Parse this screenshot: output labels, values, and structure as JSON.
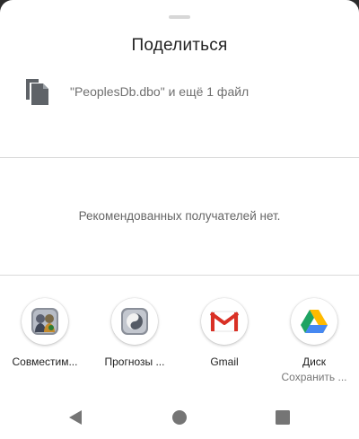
{
  "sheet": {
    "title": "Поделиться",
    "files_text": "\"PeoplesDb.dbo\" и ещё 1 файл",
    "files_icon": "copy-files-icon",
    "empty_text": "Рекомендованных получателей нет."
  },
  "apps": [
    {
      "label": "Совместим...",
      "sublabel": "",
      "icon": "compat-app-icon"
    },
    {
      "label": "Прогнозы ...",
      "sublabel": "",
      "icon": "forecast-app-icon"
    },
    {
      "label": "Gmail",
      "sublabel": "",
      "icon": "gmail-icon"
    },
    {
      "label": "Диск",
      "sublabel": "Сохранить ...",
      "icon": "google-drive-icon"
    }
  ],
  "navbar": {
    "back_icon": "back-triangle-icon",
    "home_icon": "home-circle-icon",
    "recents_icon": "recents-square-icon"
  },
  "colors": {
    "divider": "#dadada",
    "gmail_red": "#d93025",
    "drive_green": "#1ea362",
    "drive_yellow": "#ffba00",
    "drive_blue": "#4688f1"
  }
}
